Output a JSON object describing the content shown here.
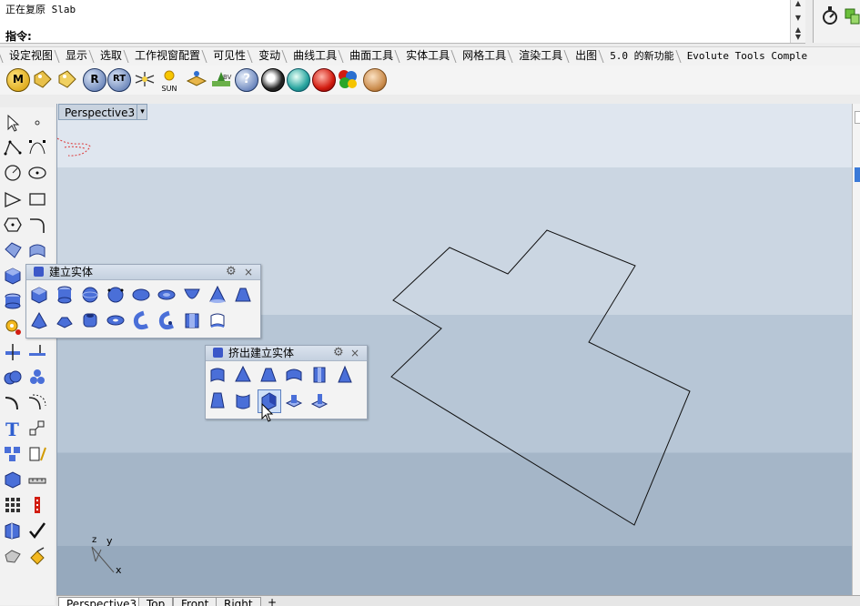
{
  "command": {
    "history_text": "正在复原 Slab",
    "prompt_label": "指令:"
  },
  "tabs": [
    "设定视图",
    "显示",
    "选取",
    "工作视窗配置",
    "可见性",
    "变动",
    "曲线工具",
    "曲面工具",
    "实体工具",
    "网格工具",
    "渲染工具",
    "出图",
    "5.0 的新功能",
    "Evolute Tools Comple"
  ],
  "icon_row": {
    "sun_label": "SUN",
    "btn_m": "M",
    "btn_r": "R",
    "btn_rt": "RT",
    "btn_help": "?"
  },
  "viewport": {
    "title": "Perspective3",
    "dropdown_glyph": "▾",
    "axis_z": "z",
    "axis_y": "y",
    "axis_x": "x"
  },
  "bottom_tabs": [
    "Perspective3",
    "Top",
    "Front",
    "Right"
  ],
  "bottom_add": "+",
  "panel_solid": {
    "title": "建立实体",
    "gear": "⚙",
    "close": "×"
  },
  "panel_extrude": {
    "title": "挤出建立实体",
    "gear": "⚙",
    "close": "×"
  },
  "colors": {
    "accent_blue": "#3c58c8",
    "viewport_band1": "#dfe6ef",
    "viewport_band4": "#96a9bd"
  }
}
